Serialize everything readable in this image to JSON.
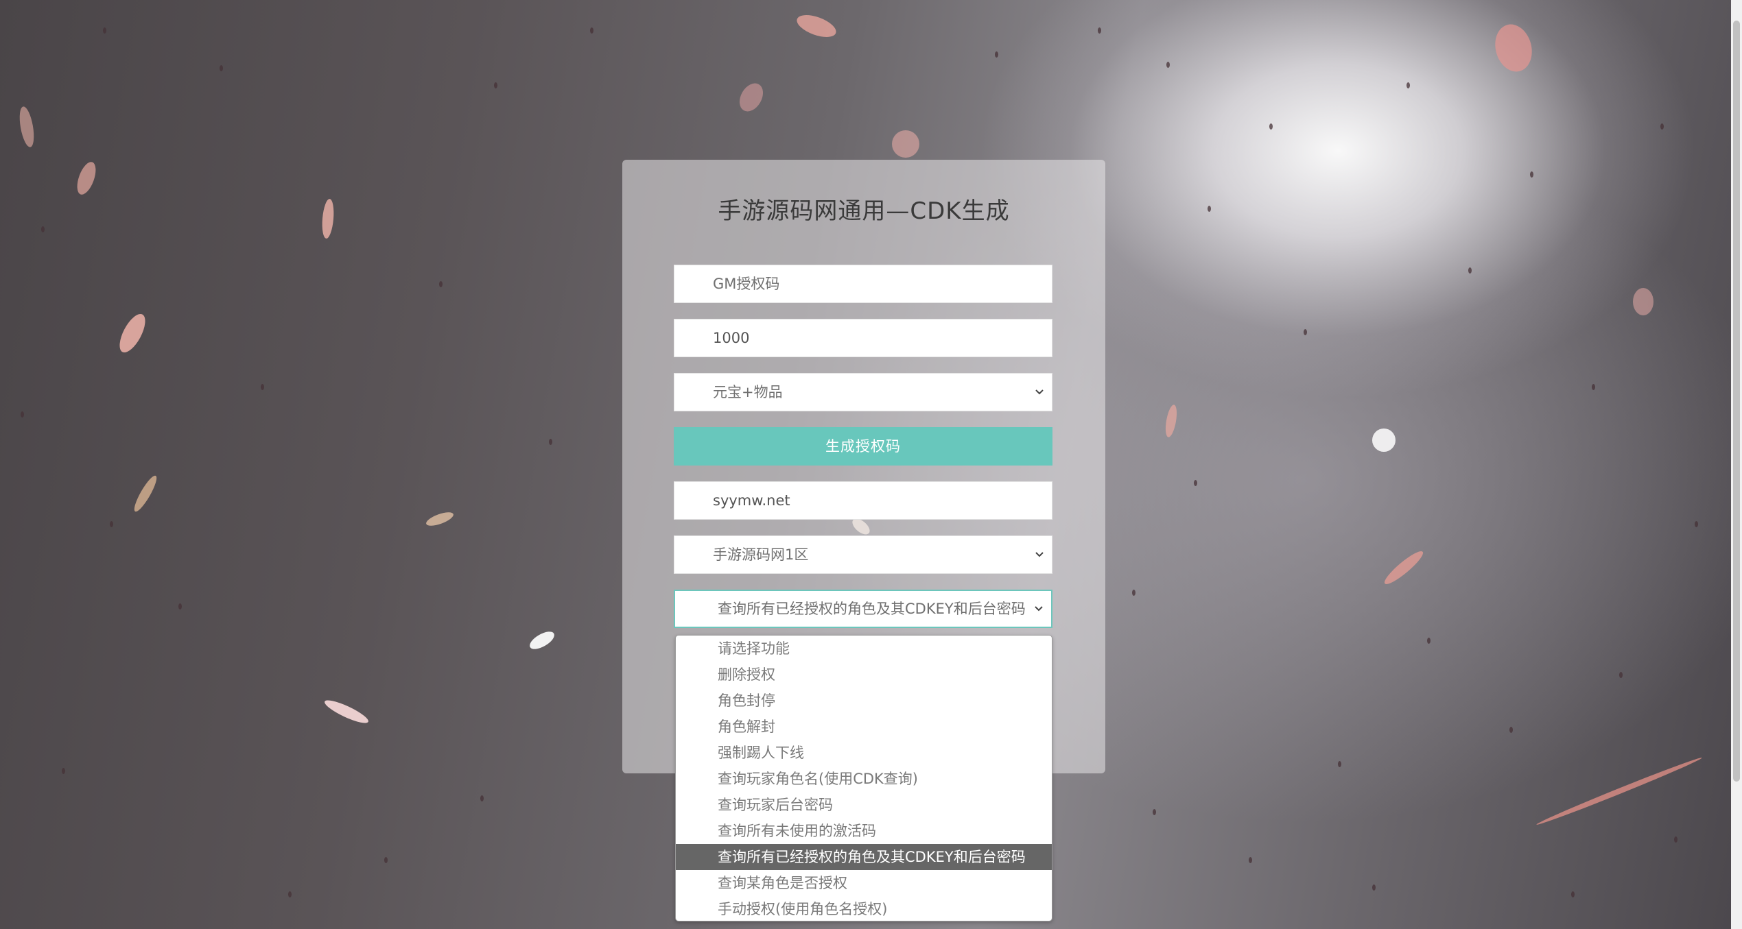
{
  "form": {
    "title": "手游源码网通用—CDK生成",
    "gm_code_placeholder": "GM授权码",
    "amount_value": "1000",
    "type_select_value": "元宝+物品",
    "generate_button_label": "生成授权码",
    "domain_value": "syymw.net",
    "server_select_value": "手游源码网1区",
    "function_select_value": "查询所有已经授权的角色及其CDKEY和后台密码"
  },
  "function_dropdown": {
    "options": [
      "请选择功能",
      "删除授权",
      "角色封停",
      "角色解封",
      "强制踢人下线",
      "查询玩家角色名(使用CDK查询)",
      "查询玩家后台密码",
      "查询所有未使用的激活码",
      "查询所有已经授权的角色及其CDKEY和后台密码",
      "查询某角色是否授权",
      "手动授权(使用角色名授权)"
    ],
    "selected_index": 8
  },
  "icons": {
    "select_arrow": "chevron-down-icon"
  },
  "colors": {
    "accent": "#68c7bc",
    "selected_option_bg": "#666666",
    "panel_bg": "rgba(235,233,236,0.52)"
  }
}
